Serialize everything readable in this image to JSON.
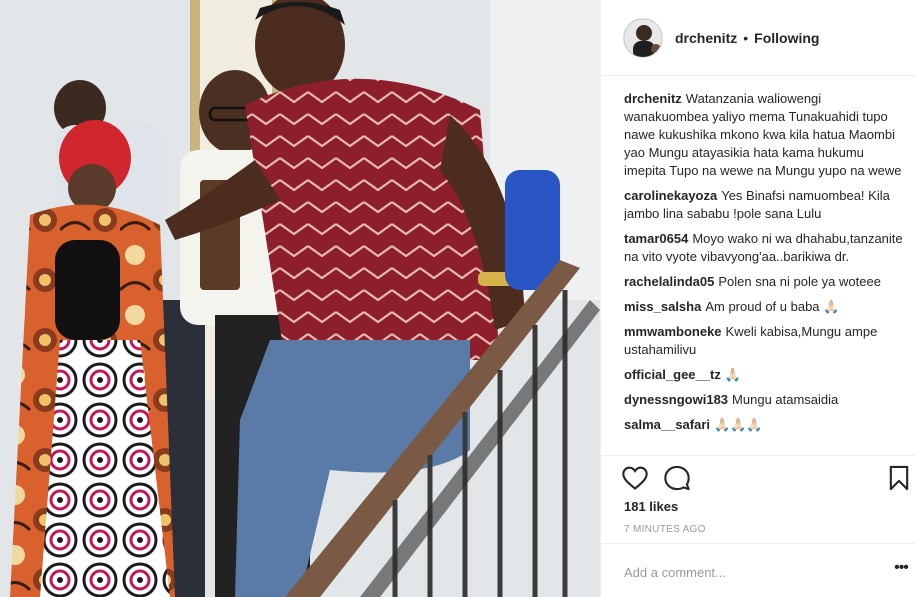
{
  "post": {
    "photo_alt": "",
    "author": "drchenitz",
    "separator": "•",
    "follow_state": "Following",
    "caption_user": "drchenitz",
    "caption_text": "Watanzania waliowengi wanakuombea yaliyo mema Tunakuahidi tupo nawe kukushika mkono kwa kila hatua Maombi yao Mungu atayasikia hata kama hukumu imepita Tupo na wewe na Mungu yupo na wewe",
    "comments": [
      {
        "user": "carolinekayoza",
        "text": "Yes Binafsi namuombea! Kila jambo lina sababu !pole sana Lulu"
      },
      {
        "user": "tamar0654",
        "text": "Moyo wako ni wa dhahabu,tanzanite na vito vyote vibavyong'aa..barikiwa dr."
      },
      {
        "user": "rachelalinda05",
        "text": "Polen sna ni pole ya woteee"
      },
      {
        "user": "miss_salsha",
        "text": "Am proud of u baba 🙏🏻"
      },
      {
        "user": "mmwamboneke",
        "text": "Kweli kabisa,Mungu ampe ustahamilivu"
      },
      {
        "user": "official_gee__tz",
        "text": "🙏🏻"
      },
      {
        "user": "dynessngowi183",
        "text": "Mungu atamsaidia"
      },
      {
        "user": "salma__safari",
        "text": "🙏🏻🙏🏻🙏🏻"
      }
    ],
    "likes": "181 likes",
    "time_ago": "7 MINUTES AGO",
    "comment_placeholder": "Add a comment...",
    "more_label": "•••"
  },
  "icons": {
    "like": "heart-icon",
    "comment": "comment-bubble-icon",
    "save": "bookmark-icon",
    "more": "more-options-icon"
  },
  "colors": {
    "text": "#262626",
    "muted": "#999999",
    "border": "#efefef"
  }
}
